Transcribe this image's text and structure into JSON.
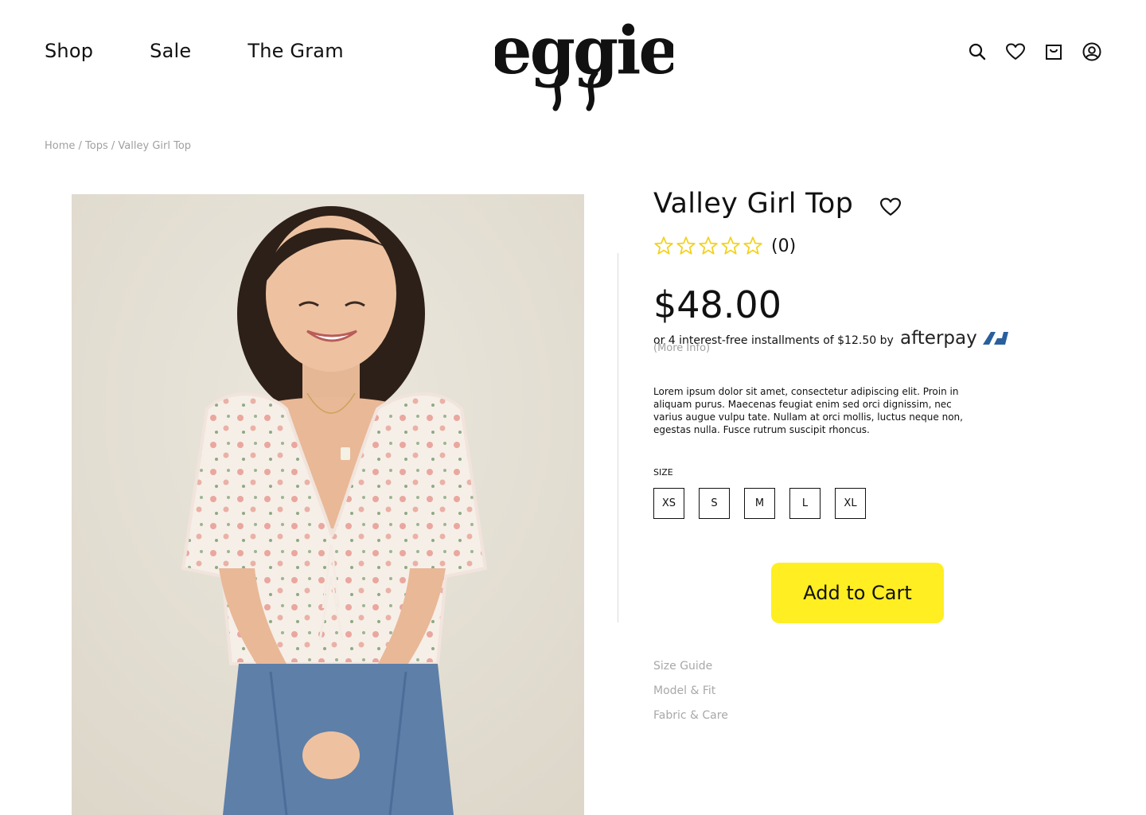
{
  "header": {
    "nav": [
      "Shop",
      "Sale",
      "The Gram"
    ],
    "logo_text": "eggie",
    "icons": [
      "search-icon",
      "heart-icon",
      "bag-icon",
      "account-icon"
    ]
  },
  "breadcrumb": {
    "home": "Home",
    "category": "Tops",
    "current": "Valley Girl Top",
    "separator": " / "
  },
  "product": {
    "title": "Valley Girl Top",
    "rating_count": "(0)",
    "stars": 5,
    "price": "$48.00",
    "afterpay_text": "or 4 interest-free installments of $12.50 by",
    "afterpay_brand": "afterpay",
    "more_info": "(More Info)",
    "description": "Lorem ipsum dolor sit amet, consectetur adipiscing elit. Proin in aliquam purus. Maecenas feugiat enim sed orci dignissim, nec varius augue vulpu tate. Nullam at orci mollis, luctus neque non, egestas nulla. Fusce rutrum suscipit rhoncus.",
    "size_label": "SIZE",
    "sizes": [
      "XS",
      "S",
      "M",
      "L",
      "XL"
    ],
    "add_to_cart": "Add to Cart",
    "accordion": [
      "Size Guide",
      "Model & Fit",
      "Fabric & Care"
    ]
  },
  "colors": {
    "accent_yellow": "#ffee22",
    "star_yellow": "#f2d21b",
    "muted_text": "#a0a0a0",
    "afterpay_blue": "#2a5f9e"
  }
}
